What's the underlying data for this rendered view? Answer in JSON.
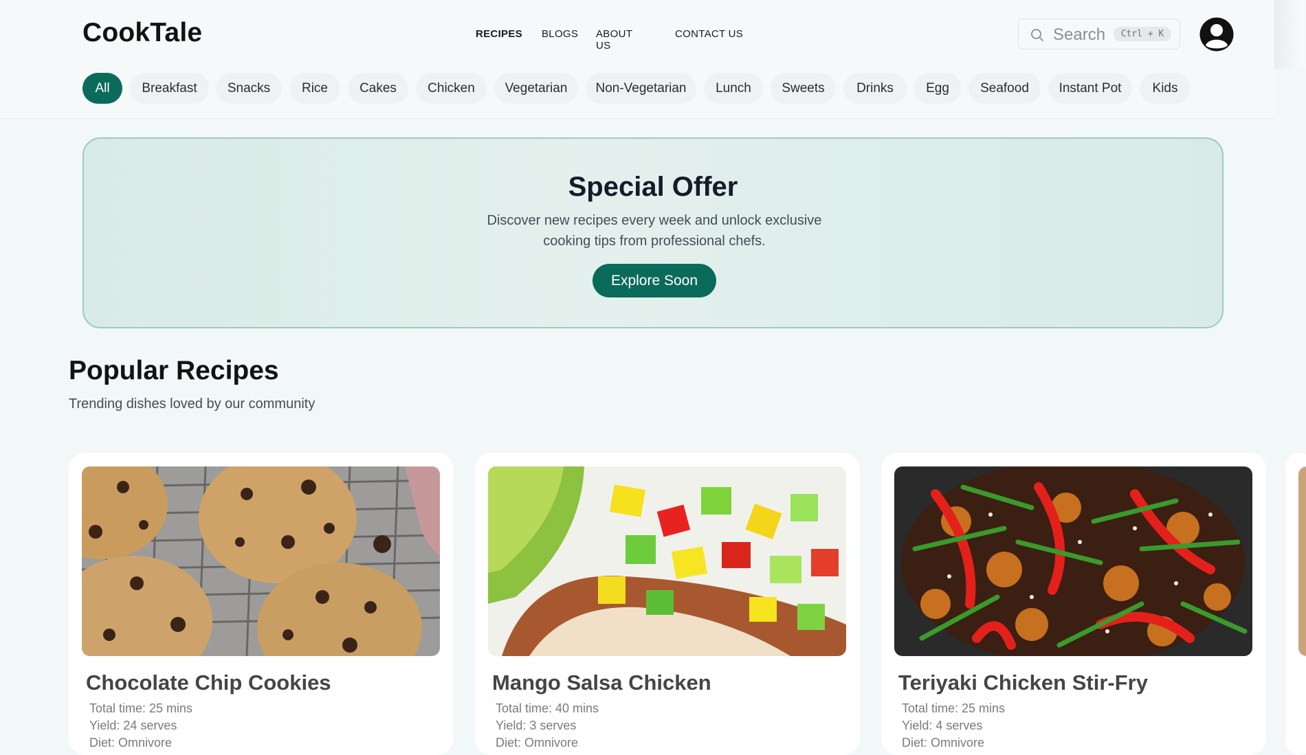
{
  "header": {
    "logo": "CookTale",
    "nav": [
      "RECIPES",
      "BLOGS",
      "ABOUT US",
      "CONTACT US"
    ],
    "search": {
      "placeholder": "Search",
      "shortcut": "Ctrl + K",
      "icon": "search-icon"
    },
    "avatar_icon": "user-avatar-icon"
  },
  "categories": [
    "All",
    "Breakfast",
    "Snacks",
    "Rice",
    "Cakes",
    "Chicken",
    "Vegetarian",
    "Non-Vegetarian",
    "Lunch",
    "Sweets",
    "Drinks",
    "Egg",
    "Seafood",
    "Instant Pot",
    "Kids"
  ],
  "active_category": "All",
  "offer": {
    "title": "Special Offer",
    "text": "Discover new recipes every week and unlock exclusive cooking tips from professional chefs.",
    "button": "Explore Soon"
  },
  "popular": {
    "title": "Popular Recipes",
    "subtitle": "Trending dishes loved by our community",
    "recipes": [
      {
        "title": "Chocolate Chip Cookies",
        "time": "Total time: 25 mins",
        "yield": "Yield: 24 serves",
        "diet": "Diet: Omnivore"
      },
      {
        "title": "Mango Salsa Chicken",
        "time": "Total time: 40 mins",
        "yield": "Yield: 3 serves",
        "diet": "Diet: Omnivore"
      },
      {
        "title": "Teriyaki Chicken Stir-Fry",
        "time": "Total time: 25 mins",
        "yield": "Yield: 4 serves",
        "diet": "Diet: Omnivore"
      }
    ]
  },
  "colors": {
    "accent": "#0b6b5b",
    "background": "#f2f7f7",
    "chip": "#eef2f4"
  }
}
